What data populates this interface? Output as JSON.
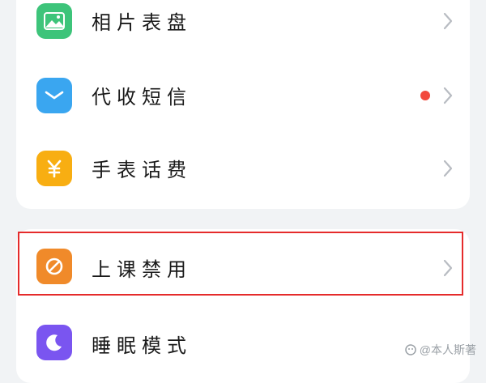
{
  "settings": {
    "items": [
      {
        "label": "相片表盘",
        "icon": "photo-icon",
        "color": "#3dc47a"
      },
      {
        "label": "代收短信",
        "icon": "message-icon",
        "color": "#3aa6f0",
        "badge_color": "#f2493d"
      },
      {
        "label": "手表话费",
        "icon": "yuan-icon",
        "color": "#f8ae12"
      },
      {
        "label": "上课禁用",
        "icon": "watch-ban-icon",
        "color": "#f08a2a"
      },
      {
        "label": "睡眠模式",
        "icon": "moon-icon",
        "color": "#7a55f0"
      }
    ]
  },
  "highlight_color": "#e52b2b",
  "watermark": "@本人斯著"
}
